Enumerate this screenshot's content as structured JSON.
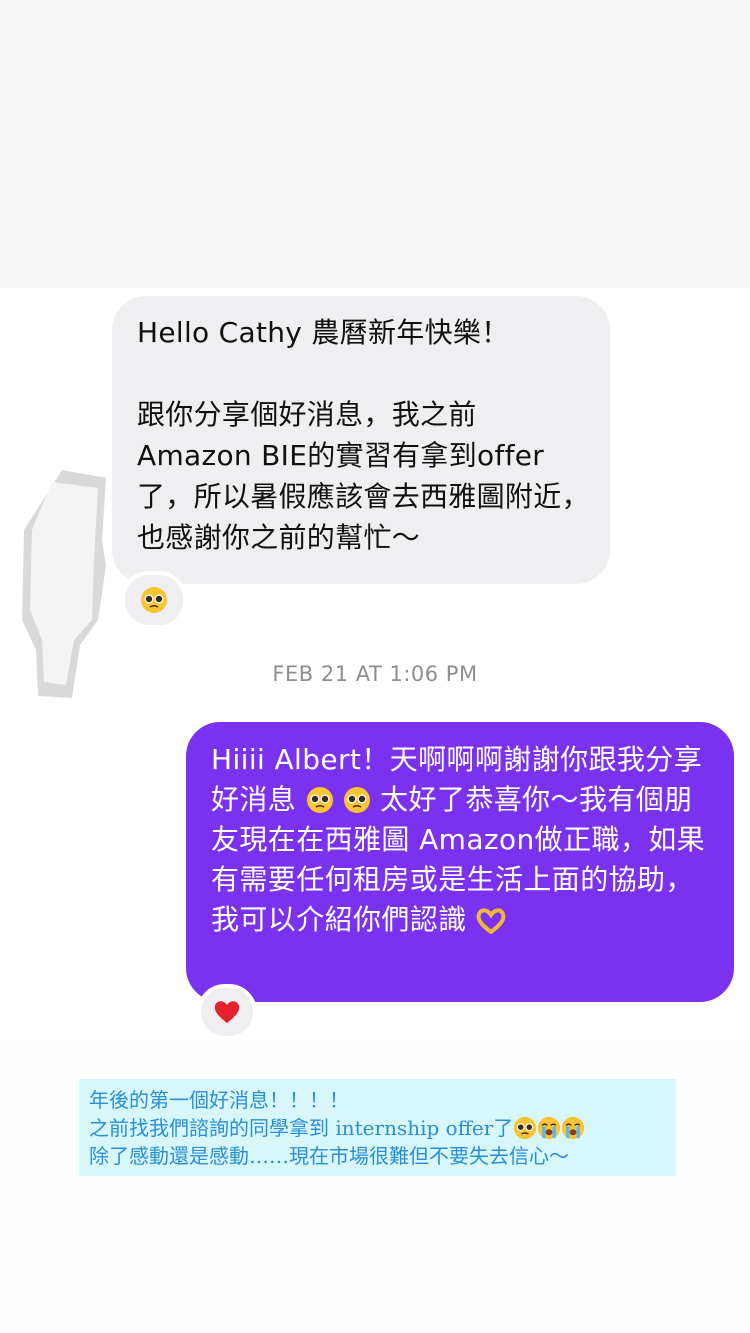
{
  "incoming": {
    "greeting": "Hello Cathy 農曆新年快樂！",
    "body": "跟你分享個好消息，我之前 Amazon BIE的實習有拿到offer了，所以暑假應該會去西雅圖附近，也感謝你之前的幫忙～",
    "reaction_icon": "pleading-face-emoji"
  },
  "timestamp": "FEB 21 AT 1:06 PM",
  "outgoing": {
    "text_part1": "Hiiii Albert！天啊啊啊謝謝你跟我分享好消息",
    "text_part2": "太好了恭喜你～我有個朋友現在在西雅圖 Amazon做正職，如果有需要任何租房或是生活上面的協助，我可以介紹你們認識",
    "inline_emojis": [
      "pleading-face-emoji",
      "pleading-face-emoji",
      "heart-hands-emoji"
    ],
    "reaction_icon": "red-heart-emoji"
  },
  "caption": {
    "line1": "年後的第一個好消息！！！！",
    "line2": "之前找我們諮詢的同學拿到 internship offer了",
    "line2_emojis": [
      "pleading-face-emoji",
      "loudly-crying-face-emoji",
      "loudly-crying-face-emoji"
    ],
    "line3": "除了感動還是感動……現在市場很難但不要失去信心～"
  },
  "colors": {
    "incoming_bubble": "#efeff1",
    "outgoing_bubble": "#7a32f0",
    "caption_background": "#d8f7fb",
    "caption_text": "#2b8fd8",
    "timestamp_text": "#8e8e93"
  }
}
